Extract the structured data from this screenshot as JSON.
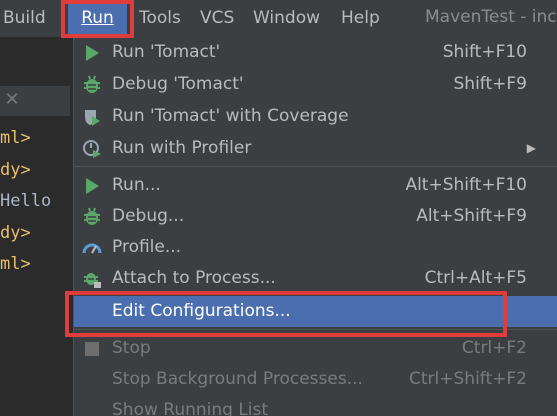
{
  "menubar": {
    "build": "Build",
    "run": "Run",
    "tools": "Tools",
    "vcs": "VCS",
    "window": "Window",
    "help": "Help",
    "app_title": "MavenTest - inc"
  },
  "editor": {
    "lines": [
      "ml>",
      "dy>",
      "Hello",
      "dy>",
      "ml>"
    ]
  },
  "run_menu": {
    "items": [
      {
        "label": "Run 'Tomact'",
        "shortcut": "Shift+F10",
        "icon": "run-icon"
      },
      {
        "label": "Debug 'Tomact'",
        "shortcut": "Shift+F9",
        "icon": "debug-icon"
      },
      {
        "label": "Run 'Tomact' with Coverage",
        "shortcut": "",
        "icon": "coverage-icon"
      },
      {
        "label": "Run with Profiler",
        "shortcut": "",
        "icon": "profiler-icon"
      },
      {
        "label": "Run...",
        "shortcut": "Alt+Shift+F10",
        "icon": "run-icon"
      },
      {
        "label": "Debug...",
        "shortcut": "Alt+Shift+F9",
        "icon": "debug-icon"
      },
      {
        "label": "Profile...",
        "shortcut": "",
        "icon": "profile-gauge-icon"
      },
      {
        "label": "Attach to Process...",
        "shortcut": "Ctrl+Alt+F5",
        "icon": "attach-icon"
      },
      {
        "label": "Edit Configurations...",
        "shortcut": "",
        "icon": ""
      },
      {
        "label": "Stop",
        "shortcut": "Ctrl+F2",
        "icon": "stop-icon"
      },
      {
        "label": "Stop Background Processes...",
        "shortcut": "Ctrl+Shift+F2",
        "icon": ""
      },
      {
        "label": "Show Running List",
        "shortcut": "",
        "icon": ""
      }
    ]
  },
  "colors": {
    "accent": "#4b6eaf",
    "highlight_box": "#e03c3c",
    "run_green": "#59a869",
    "menu_bg": "#3c3f41"
  }
}
